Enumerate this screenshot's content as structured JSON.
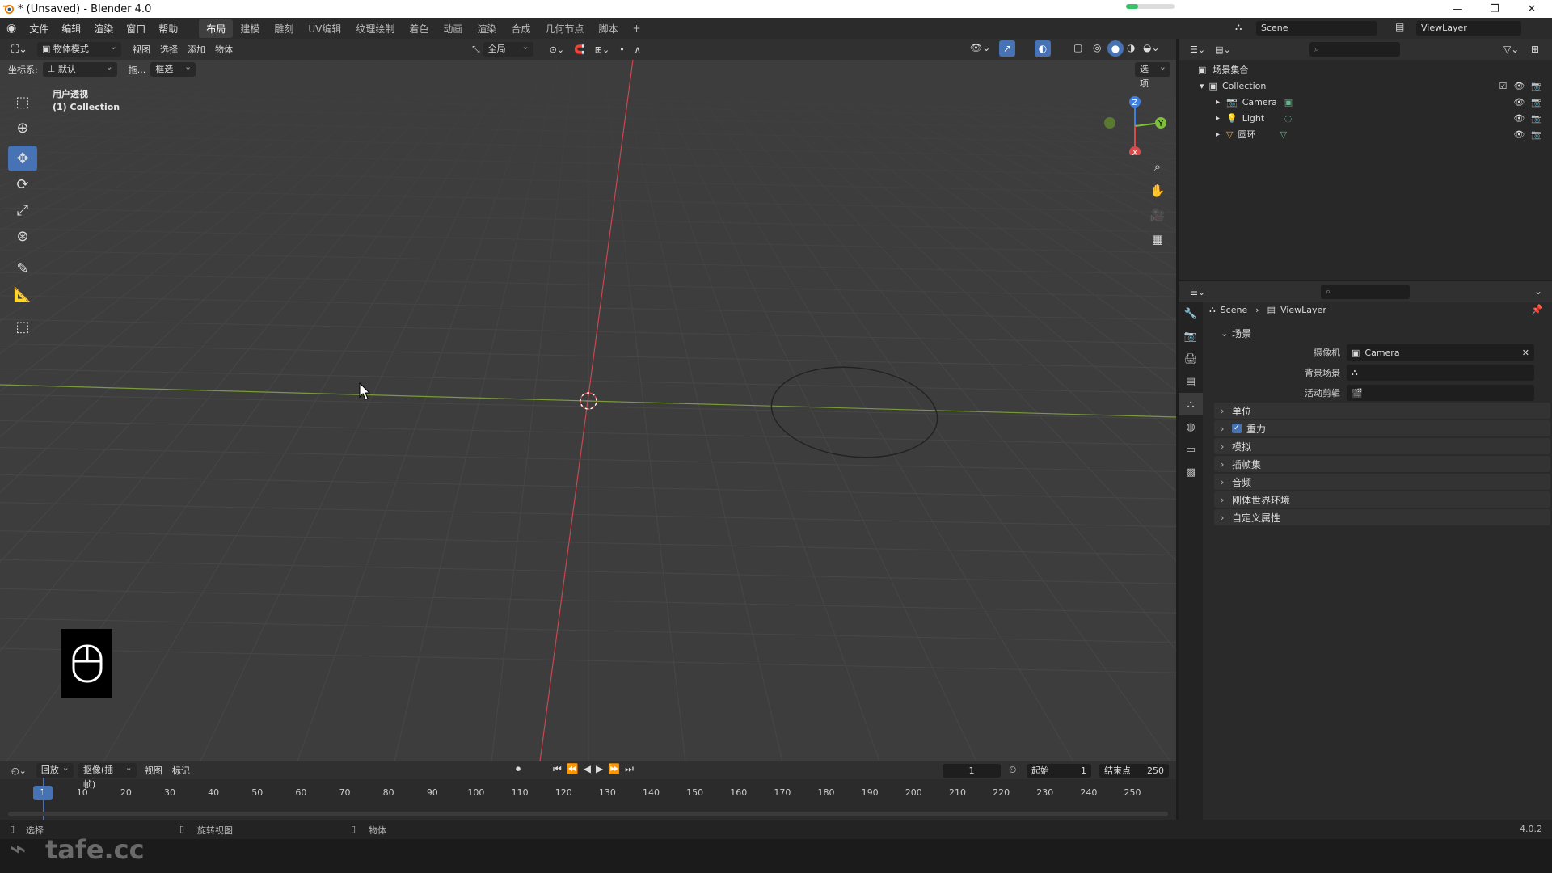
{
  "window": {
    "title": "* (Unsaved) - Blender 4.0",
    "progress": 0.25,
    "minimize_glyph": "—",
    "maximize_glyph": "❐",
    "close_glyph": "✕"
  },
  "menubar": {
    "menus": [
      "文件",
      "编辑",
      "渲染",
      "窗口",
      "帮助"
    ],
    "workspaces": [
      "布局",
      "建模",
      "雕刻",
      "UV编辑",
      "纹理绘制",
      "着色",
      "动画",
      "渲染",
      "合成",
      "几何节点",
      "脚本"
    ],
    "active_workspace": "布局",
    "add_tab": "+",
    "scene": "Scene",
    "view_layer": "ViewLayer"
  },
  "viewport": {
    "mode": "物体模式",
    "menus": [
      "视图",
      "选择",
      "添加",
      "物体"
    ],
    "transform_orientation": "全局",
    "coord_label": "坐标系:",
    "coord_value": "默认",
    "drag_label": "拖...",
    "select_box": "框选",
    "options": "选项",
    "overlay_view": "用户透视",
    "overlay_collection": "(1) Collection",
    "gizmo_axes": {
      "x": "X",
      "y": "Y",
      "z": "Z"
    }
  },
  "timeline": {
    "playback": "回放",
    "keying": "抠像(插帧)",
    "view": "视图",
    "marker": "标记",
    "current_frame": "1",
    "start_label": "起始",
    "start": "1",
    "end_label": "结束点",
    "end": "250",
    "ticks": [
      "1",
      "10",
      "20",
      "30",
      "40",
      "50",
      "60",
      "70",
      "80",
      "90",
      "100",
      "110",
      "120",
      "130",
      "140",
      "150",
      "160",
      "170",
      "180",
      "190",
      "200",
      "210",
      "220",
      "230",
      "240",
      "250"
    ]
  },
  "statusbar": {
    "select": "选择",
    "rotate": "旋转视图",
    "object": "物体",
    "version": "4.0.2",
    "watermark": "tafe.cc"
  },
  "outliner": {
    "root": "场景集合",
    "collection": "Collection",
    "items": [
      {
        "name": "Camera"
      },
      {
        "name": "Light"
      },
      {
        "name": "圆环"
      }
    ]
  },
  "properties": {
    "breadcrumb_scene": "Scene",
    "breadcrumb_layer": "ViewLayer",
    "scene_panel": "场景",
    "camera_label": "摄像机",
    "camera_value": "Camera",
    "background_label": "背景场景",
    "clip_label": "活动剪辑",
    "panels": [
      "单位",
      "重力",
      "模拟",
      "插帧集",
      "音频",
      "刚体世界环境",
      "自定义属性"
    ],
    "gravity_checked": true
  }
}
